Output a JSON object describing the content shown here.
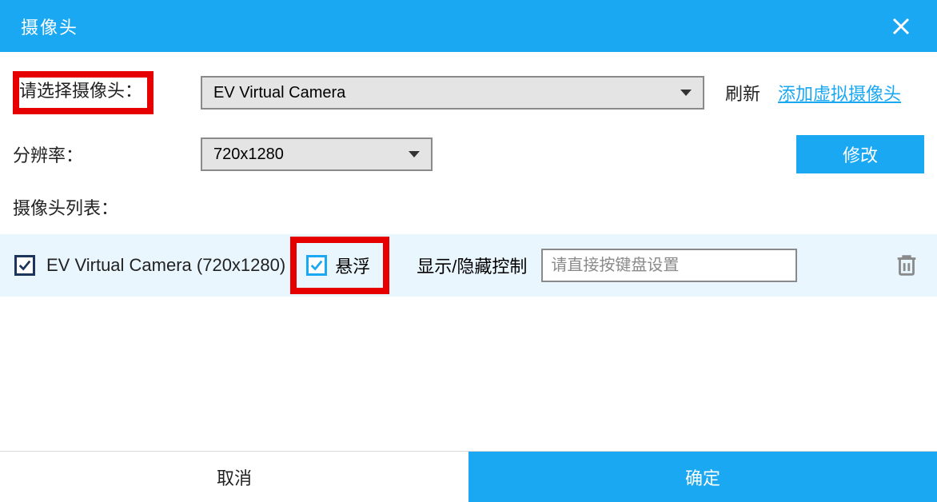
{
  "title": "摄像头",
  "labels": {
    "select_camera": "请选择摄像头：",
    "resolution": "分辨率：",
    "camera_list": "摄像头列表："
  },
  "camera_select": {
    "value": "EV Virtual Camera"
  },
  "resolution_select": {
    "value": "720x1280"
  },
  "refresh": "刷新",
  "add_virtual": "添加虚拟摄像头",
  "modify": "修改",
  "item": {
    "name": "EV Virtual Camera (720x1280)",
    "float_label": "悬浮",
    "toggle_label": "显示/隐藏控制",
    "key_placeholder": "请直接按键盘设置"
  },
  "footer": {
    "cancel": "取消",
    "ok": "确定"
  }
}
